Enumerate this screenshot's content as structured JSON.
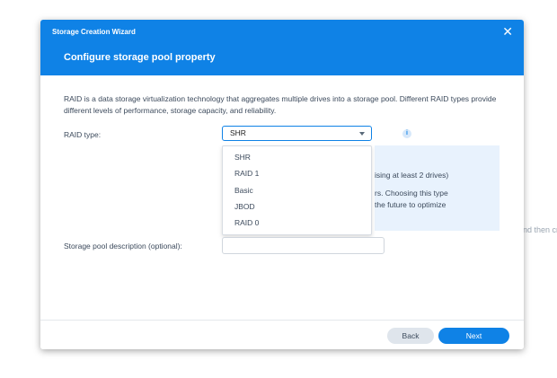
{
  "background": {
    "text": "nd then cr"
  },
  "wizard": {
    "title": "Storage Creation Wizard",
    "close_symbol": "✕",
    "page_title": "Configure storage pool property",
    "description": "RAID is a data storage virtualization technology that aggregates multiple drives into a storage pool. Different RAID types provide different levels of performance, storage capacity, and reliability.",
    "raid_type": {
      "label": "RAID type:",
      "selected": "SHR",
      "options": [
        "SHR",
        "RAID 1",
        "Basic",
        "JBOD",
        "RAID 0"
      ],
      "info_icon": "i"
    },
    "info_panel": {
      "line1": "ising at least 2 drives)",
      "line2": "rs. Choosing this type",
      "line3": "the future to optimize"
    },
    "pool_description": {
      "label": "Storage pool description (optional):",
      "value": ""
    },
    "footer": {
      "back_label": "Back",
      "next_label": "Next"
    }
  },
  "colors": {
    "accent": "#0f82e6",
    "header_bg": "#0f82e6",
    "info_panel_bg": "#e8f2fd",
    "secondary_button_bg": "#dfe5ec"
  }
}
